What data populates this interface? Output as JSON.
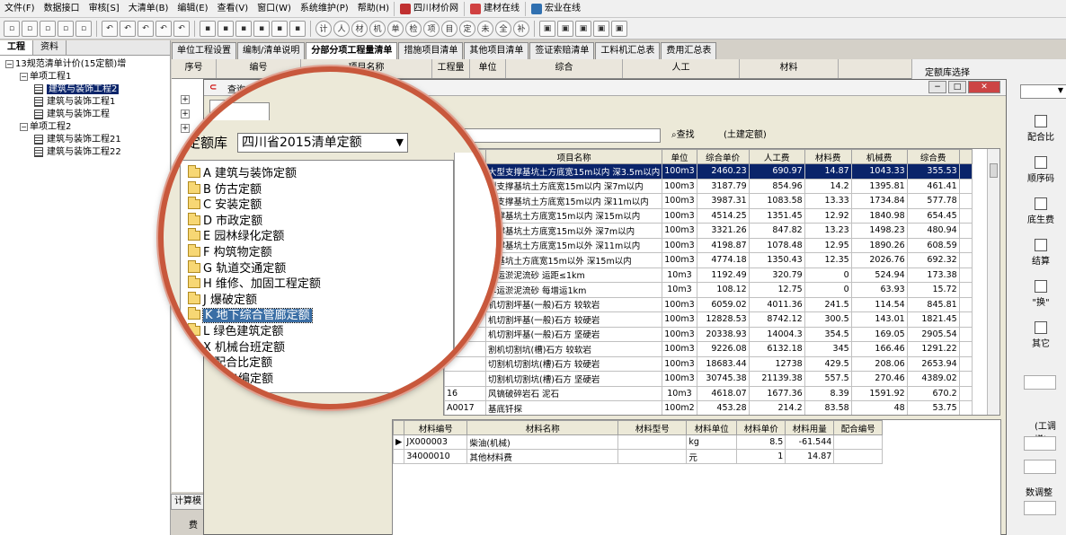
{
  "menu": [
    "文件(F)",
    "数据接口",
    "审核[S]",
    "大清单(B)",
    "编辑(E)",
    "查看(V)",
    "窗口(W)",
    "系统维护(P)",
    "帮助(H)"
  ],
  "menu_ext": [
    {
      "label": "四川材价网",
      "icon": "grid-icon",
      "color": "#c03030"
    },
    {
      "label": "建材在线",
      "icon": "swirl-logo-icon",
      "color": "#d04040"
    },
    {
      "label": "宏业在线",
      "icon": "person-icon",
      "color": "#3070b0"
    }
  ],
  "toolbar_text": [
    "计",
    "人",
    "材",
    "机",
    "单",
    "检",
    "项",
    "目",
    "定",
    "未",
    "全",
    "补"
  ],
  "left": {
    "tabs": [
      "工程",
      "资料"
    ],
    "tree": [
      {
        "level": 0,
        "box": "−",
        "label": "13规范清单计价(15定额)增"
      },
      {
        "level": 1,
        "box": "−",
        "label": "单项工程1"
      },
      {
        "level": 2,
        "label": "建筑与装饰工程2",
        "selected": true
      },
      {
        "level": 2,
        "label": "建筑与装饰工程1"
      },
      {
        "level": 2,
        "label": "建筑与装饰工程"
      },
      {
        "level": 1,
        "box": "−",
        "label": "单项工程2"
      },
      {
        "level": 2,
        "label": "建筑与装饰工程21"
      },
      {
        "level": 2,
        "label": "建筑与装饰工程22"
      }
    ],
    "calc_tab": "计算模",
    "fee_label": "费"
  },
  "tabs": [
    "单位工程设置",
    "编制/清单说明",
    "分部分项工程量清单",
    "措施项目清单",
    "其他项目清单",
    "签证索赔清单",
    "工料机汇总表",
    "费用汇总表"
  ],
  "active_tab": 2,
  "main_header": [
    "序号",
    "编号",
    "项目名称",
    "工程量",
    "单位",
    "综合",
    "人工",
    "材料"
  ],
  "right_panel": {
    "title": "定额库选择",
    "buttons": [
      "配合比",
      "顺序码",
      "底生费",
      "结算",
      "\"换\"",
      "其它"
    ],
    "adjust_label": "工调增)",
    "adjust_prefix": "(",
    "tax_label": "数调整"
  },
  "query": {
    "title": "查询",
    "name_field": "名称",
    "search_value": "",
    "find_label": "查找",
    "hint": "(土建定额)",
    "columns": [
      "项目名称",
      "单位",
      "综合单价",
      "人工费",
      "材料费",
      "机械费",
      "综合费"
    ],
    "rows": [
      {
        "code": "",
        "name": "大型支撑基坑土方底宽15m以内 深3.5m以内",
        "unit": "100m3",
        "price": "2460.23",
        "labor": "690.97",
        "mat": "14.87",
        "mach": "1043.33",
        "comp": "355.53"
      },
      {
        "code": "",
        "name": "型支撑基坑土方底宽15m以内 深7m以内",
        "unit": "100m3",
        "price": "3187.79",
        "labor": "854.96",
        "mat": "14.2",
        "mach": "1395.81",
        "comp": "461.41"
      },
      {
        "code": "",
        "name": "型支撑基坑土方底宽15m以内 深11m以内",
        "unit": "100m3",
        "price": "3987.31",
        "labor": "1083.58",
        "mat": "13.33",
        "mach": "1734.84",
        "comp": "577.78"
      },
      {
        "code": "",
        "name": "支撑基坑土方底宽15m以内 深15m以内",
        "unit": "100m3",
        "price": "4514.25",
        "labor": "1351.45",
        "mat": "12.92",
        "mach": "1840.98",
        "comp": "654.45"
      },
      {
        "code": "",
        "name": "支撑基坑土方底宽15m以外 深7m以内",
        "unit": "100m3",
        "price": "3321.26",
        "labor": "847.82",
        "mat": "13.23",
        "mach": "1498.23",
        "comp": "480.94"
      },
      {
        "code": "",
        "name": "支撑基坑土方底宽15m以外 深11m以内",
        "unit": "100m3",
        "price": "4198.87",
        "labor": "1078.48",
        "mat": "12.95",
        "mach": "1890.26",
        "comp": "608.59"
      },
      {
        "code": "",
        "name": "撑基坑土方底宽15m以外 深15m以内",
        "unit": "100m3",
        "price": "4774.18",
        "labor": "1350.43",
        "mat": "12.35",
        "mach": "2026.76",
        "comp": "692.32"
      },
      {
        "code": "",
        "name": "车运淤泥流砂 运距≤1km",
        "unit": "10m3",
        "price": "1192.49",
        "labor": "320.79",
        "mat": "0",
        "mach": "524.94",
        "comp": "173.38"
      },
      {
        "code": "",
        "name": "车运淤泥流砂 每增运1km",
        "unit": "10m3",
        "price": "108.12",
        "labor": "12.75",
        "mat": "0",
        "mach": "63.93",
        "comp": "15.72"
      },
      {
        "code": "",
        "name": "机切割坪基(一般)石方 较软岩",
        "unit": "100m3",
        "price": "6059.02",
        "labor": "4011.36",
        "mat": "241.5",
        "mach": "114.54",
        "comp": "845.81"
      },
      {
        "code": "",
        "name": "机切割坪基(一般)石方 较硬岩",
        "unit": "100m3",
        "price": "12828.53",
        "labor": "8742.12",
        "mat": "300.5",
        "mach": "143.01",
        "comp": "1821.45"
      },
      {
        "code": "",
        "name": "机切割坪基(一般)石方 坚硬岩",
        "unit": "100m3",
        "price": "20338.93",
        "labor": "14004.3",
        "mat": "354.5",
        "mach": "169.05",
        "comp": "2905.54"
      },
      {
        "code": "",
        "name": "割机切割坑(槽)石方 较软岩",
        "unit": "100m3",
        "price": "9226.08",
        "labor": "6132.18",
        "mat": "345",
        "mach": "166.46",
        "comp": "1291.22"
      },
      {
        "code": "",
        "name": "切割机切割坑(槽)石方 较硬岩",
        "unit": "100m3",
        "price": "18683.44",
        "labor": "12738",
        "mat": "429.5",
        "mach": "208.06",
        "comp": "2653.94"
      },
      {
        "code": "",
        "name": "切割机切割坑(槽)石方 坚硬岩",
        "unit": "100m3",
        "price": "30745.38",
        "labor": "21139.38",
        "mat": "557.5",
        "mach": "270.46",
        "comp": "4389.02"
      },
      {
        "code": "16",
        "name": "风镐破碎岩石 泥石",
        "unit": "10m3",
        "price": "4618.07",
        "labor": "1677.36",
        "mat": "8.39",
        "mach": "1591.92",
        "comp": "670.2"
      },
      {
        "code": "A0017",
        "name": "基底钎探",
        "unit": "100m2",
        "price": "453.28",
        "labor": "214.2",
        "mat": "83.58",
        "mach": "48",
        "comp": "53.75"
      }
    ],
    "mat_columns": [
      "材料编号",
      "材料名称",
      "材料型号",
      "材料单位",
      "材料单价",
      "材料用量",
      "配合编号"
    ],
    "mat_rows": [
      {
        "code": "JX000003",
        "name": "柴油(机械)",
        "model": "",
        "unit": "kg",
        "price": "8.5",
        "qty": "-61.544",
        "mix": ""
      },
      {
        "code": "34000010",
        "name": "其他材料费",
        "model": "",
        "unit": "元",
        "price": "1",
        "qty": "14.87",
        "mix": ""
      }
    ]
  },
  "magnifier": {
    "lib_label": "定额库",
    "lib_value": "四川省2015清单定额",
    "items": [
      "A 建筑与装饰定额",
      "B 仿古定额",
      "C 安装定额",
      "D 市政定额",
      "E 园林绿化定额",
      "F 构筑物定额",
      "G 轨道交通定额",
      "H 维修、加固工程定额",
      "J 爆破定额",
      "K 地下综合管廊定额",
      "L 绿色建筑定额",
      "X 机械台班定额",
      "Y 配合比定额",
      "用户自编定额"
    ],
    "selected": 9
  }
}
